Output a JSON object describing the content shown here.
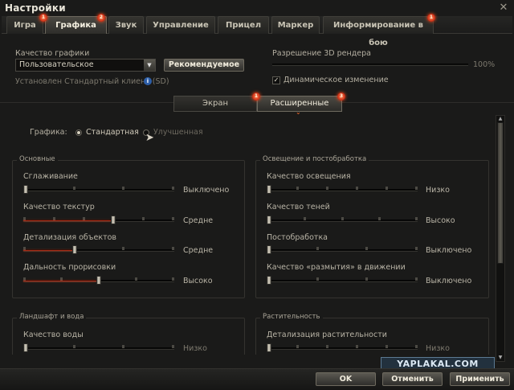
{
  "window": {
    "title": "Настройки",
    "close_symbol": "✕"
  },
  "tabs": [
    {
      "label": "Игра",
      "badge": "1"
    },
    {
      "label": "Графика",
      "badge": "2",
      "active": true
    },
    {
      "label": "Звук"
    },
    {
      "label": "Управление"
    },
    {
      "label": "Прицел"
    },
    {
      "label": "Маркер"
    },
    {
      "label": "Информирование в бою",
      "badge": "1"
    }
  ],
  "quality": {
    "label": "Качество графики",
    "selected": "Пользовательское",
    "recommended_button": "Рекомендуемое",
    "client_info": "Установлен Стандартный клиент (SD)"
  },
  "resolution": {
    "label": "Разрешение 3D рендера",
    "value": "100%",
    "dynamic_label": "Динамическое изменение",
    "dynamic_checked": true
  },
  "subtabs": {
    "screen": {
      "label": "Экран",
      "badge": "1"
    },
    "advanced": {
      "label": "Расширенные",
      "badge": "3"
    }
  },
  "graphics_mode": {
    "label": "Графика:",
    "standard": "Стандартная",
    "improved": "Улучшенная",
    "selected": "standard"
  },
  "sections": {
    "basic": {
      "title": "Основные",
      "sliders": [
        {
          "label": "Сглаживание",
          "value": "Выключено",
          "level": 0,
          "steps": 4
        },
        {
          "label": "Качество текстур",
          "value": "Средне",
          "level": 3,
          "steps": 6
        },
        {
          "label": "Детализация объектов",
          "value": "Средне",
          "level": 1,
          "steps": 4
        },
        {
          "label": "Дальность прорисовки",
          "value": "Высоко",
          "level": 2,
          "steps": 5
        }
      ]
    },
    "lighting": {
      "title": "Освещение и постобработка",
      "sliders": [
        {
          "label": "Качество освещения",
          "value": "Низко",
          "level": 0,
          "steps": 6
        },
        {
          "label": "Качество теней",
          "value": "Высоко",
          "level": 0,
          "steps": 5
        },
        {
          "label": "Постобработка",
          "value": "Выключено",
          "level": 0,
          "steps": 4
        },
        {
          "label": "Качество «размытия» в движении",
          "value": "Выключено",
          "level": 0,
          "steps": 4
        }
      ]
    },
    "landscape": {
      "title": "Ландшафт и вода",
      "sliders": [
        {
          "label": "Качество воды",
          "value": "Низко",
          "level": 0,
          "steps": 4
        }
      ]
    },
    "vegetation": {
      "title": "Растительность",
      "sliders": [
        {
          "label": "Детализация растительности",
          "value": "Низко",
          "level": 0,
          "steps": 6
        }
      ]
    }
  },
  "footer": {
    "ok": "OK",
    "cancel": "Отменить",
    "apply": "Применить"
  },
  "watermark": "YAPLAKAL.COM",
  "colors": {
    "accent_red": "#a52a16",
    "badge_orange": "#e0401a",
    "bg": "#1a1a19"
  }
}
